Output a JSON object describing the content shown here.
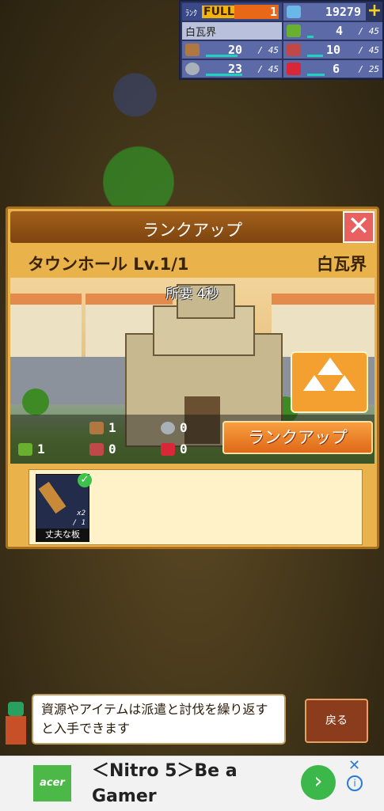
{
  "hud": {
    "rank_label": "ﾗﾝｸ",
    "rank_status": "FULL",
    "rank_value": "1",
    "gems": "19279",
    "region": "白瓦界",
    "resources": [
      {
        "icon": "grass-icon",
        "value": "4",
        "max": "/ 45",
        "level": 0.09
      },
      {
        "icon": "wood-icon",
        "value": "20",
        "max": "/ 45",
        "level": 0.44
      },
      {
        "icon": "food-icon",
        "value": "10",
        "max": "/ 45",
        "level": 0.22
      },
      {
        "icon": "stone-icon",
        "value": "23",
        "max": "/ 45",
        "level": 0.51
      },
      {
        "icon": "ruby-icon",
        "value": "6",
        "max": "/ 25",
        "level": 0.24
      }
    ]
  },
  "dialog": {
    "title": "ランクアップ",
    "facility": "タウンホール Lv.1/1",
    "region": "白瓦界",
    "time_required": "所要 4秒",
    "costs": {
      "grass": "1",
      "wood": "1",
      "food": "0",
      "stone": "0",
      "ruby": "0"
    },
    "rank_up_button": "ランクアップ",
    "required_items": [
      {
        "name": "丈夫な板",
        "count": "x2",
        "need": "/ 1"
      }
    ]
  },
  "footer": {
    "hint": "資源やアイテムは派遣と討伐を繰り返すと入手できます",
    "back_label": "戻る"
  },
  "ad": {
    "brand": "acer",
    "headline": "＜Nitro 5＞Be a Gamer"
  },
  "colors": {
    "accent": "#e86818",
    "hud_bg": "#2b3560",
    "dialog_bg": "#e9b24a"
  }
}
